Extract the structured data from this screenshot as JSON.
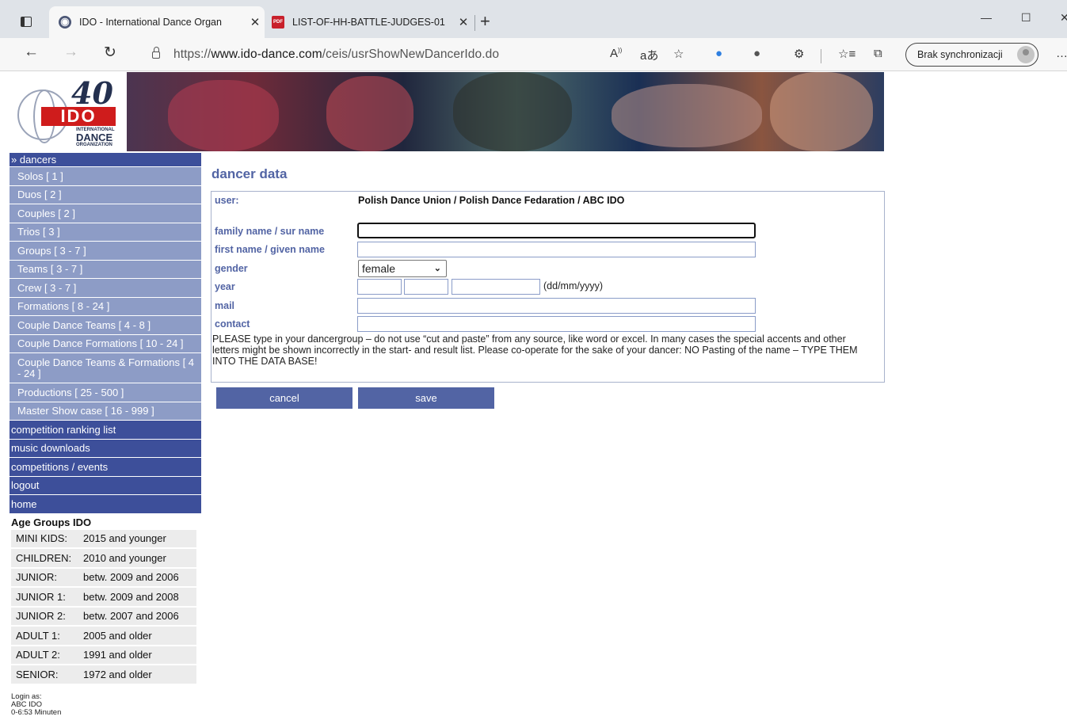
{
  "browser": {
    "tabs": [
      {
        "title": "IDO - International Dance Organ",
        "active": true
      },
      {
        "title": "LIST-OF-HH-BATTLE-JUDGES-01",
        "active": false
      }
    ],
    "address": {
      "scheme": "https://",
      "host": "www.ido-dance.com",
      "path": "/ceis/usrShowNewDancerIdo.do"
    },
    "profile_label": "Brak synchronizacji"
  },
  "logo": {
    "number": "40",
    "brand": "IDO",
    "sub1": "INTERNATIONAL",
    "sub2": "DANCE",
    "sub3": "ORGANIZATION"
  },
  "sidebar": {
    "section": "» dancers",
    "items": [
      "Solos [ 1 ]",
      "Duos [ 2 ]",
      "Couples [ 2 ]",
      "Trios [ 3 ]",
      "Groups [ 3 - 7 ]",
      "Teams [ 3 - 7 ]",
      "Crew [ 3 - 7 ]",
      "Formations [ 8 - 24 ]",
      "Couple Dance Teams [ 4 - 8 ]",
      "Couple Dance Formations [ 10 - 24 ]",
      "Couple Dance Teams & Formations [ 4 - 24 ]",
      "Productions [ 25 - 500 ]",
      "Master Show case [ 16 - 999 ]"
    ],
    "main_links": [
      "competition ranking list",
      "music downloads",
      "competitions / events",
      "logout",
      "home"
    ],
    "age_groups_title": "Age Groups IDO",
    "age_groups": [
      {
        "name": "MINI KIDS:",
        "range": "2015 and younger"
      },
      {
        "name": "CHILDREN:",
        "range": "2010 and younger"
      },
      {
        "name": "JUNIOR:",
        "range": "betw. 2009 and 2006"
      },
      {
        "name": "JUNIOR 1:",
        "range": "betw. 2009 and 2008"
      },
      {
        "name": "JUNIOR 2:",
        "range": "betw. 2007 and 2006"
      },
      {
        "name": "ADULT 1:",
        "range": "2005 and older"
      },
      {
        "name": "ADULT 2:",
        "range": "1991 and older"
      },
      {
        "name": "SENIOR:",
        "range": "1972 and older"
      }
    ],
    "login": {
      "line1": "Login as:",
      "line2": "ABC IDO",
      "line3": "0-6:53 Minuten"
    }
  },
  "main": {
    "title": "dancer data",
    "user_label": "user:",
    "user_value": "Polish Dance Union / Polish Dance Fedaration / ABC IDO",
    "family_label": "family name / sur name",
    "family_value": "",
    "first_label": "first name / given name",
    "first_value": "",
    "gender_label": "gender",
    "gender_value": "female",
    "year_label": "year",
    "year_hint": "(dd/mm/yyyy)",
    "mail_label": "mail",
    "contact_label": "contact",
    "notice": "PLEASE type in your dancergroup – do not use “cut and paste” from any source, like word or excel. In many cases the special accents and other letters might be shown incorrectly in the start- and result list. Please co-operate for the sake of your dancer: NO Pasting of the name – TYPE THEM INTO THE DATA BASE!",
    "cancel_label": "cancel",
    "save_label": "save"
  },
  "colors": {
    "nav_dark": "#3d4f9a",
    "nav_light": "#8d9cc6",
    "accent": "#5264a4"
  }
}
